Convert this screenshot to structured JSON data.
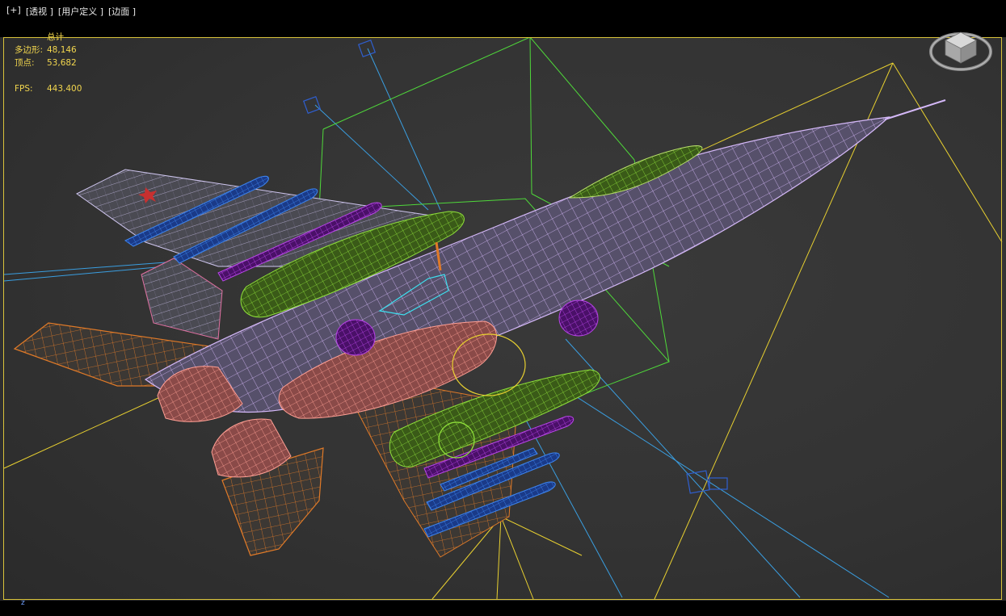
{
  "viewport": {
    "labels": [
      "[+]",
      "[透视 ]",
      "[用户定义 ]",
      "[边面 ]"
    ],
    "stats": {
      "header": "总计",
      "polygons_label": "多边形:",
      "polygons_value": "48,146",
      "vertices_label": "顶点:",
      "vertices_value": "53,682",
      "fps_label": "FPS:",
      "fps_value": "443.400"
    },
    "axis_label": "z"
  },
  "colors": {
    "border": "#d8c23a",
    "stats_text": "#f2d64e",
    "wire_fuselage": "#c8a8f0",
    "wire_green": "#7ec832",
    "wire_blue": "#2f6fd0",
    "wire_purple": "#9a2fc8",
    "wire_salmon": "#f08a80",
    "wire_orange": "#e07a28",
    "light_blue": "#3a9ee0",
    "light_yellow": "#e8d030"
  }
}
